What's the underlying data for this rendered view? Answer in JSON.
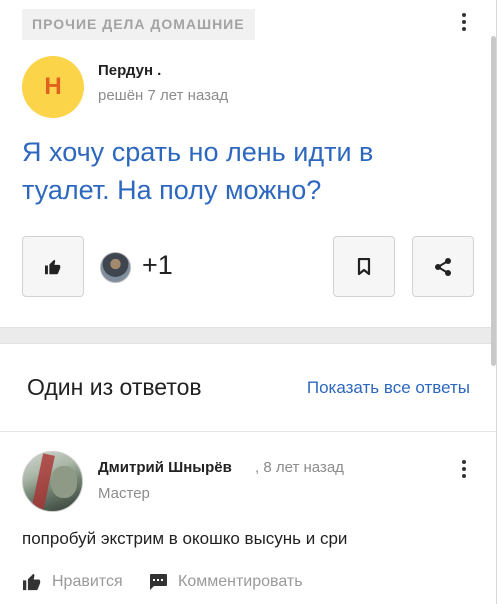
{
  "question": {
    "category": "ПРОЧИЕ ДЕЛА ДОМАШНИЕ",
    "author": {
      "initial": "Н",
      "name": "Пердун .",
      "status": "решён 7 лет назад"
    },
    "title": "Я хочу срать но лень идти в туалет. На полу можно?",
    "vote_count": "+1",
    "colors": {
      "link": "#2d68be",
      "avatar_bg": "#fbd44a",
      "avatar_text": "#e0621e"
    }
  },
  "answers": {
    "heading": "Один из ответов",
    "show_all": "Показать все ответы",
    "answer": {
      "author": "Дмитрий Шнырёв",
      "time": ", 8 лет назад",
      "rank": "Мастер",
      "text": "попробуй экстрим в окошко высунь и сри",
      "like_label": "Нравится",
      "comment_label": "Комментировать"
    }
  }
}
